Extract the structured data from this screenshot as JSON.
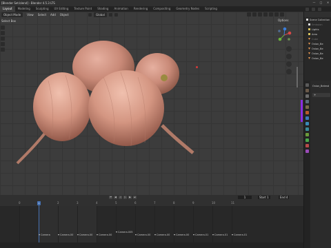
{
  "window": {
    "title": "[Blender Set.blend] - Blender 4.5.3 LTS"
  },
  "workspace_tabs": [
    "Layout",
    "Modeling",
    "Sculpting",
    "UV Editing",
    "Texture Paint",
    "Shading",
    "Animation",
    "Rendering",
    "Compositing",
    "Geometry Nodes",
    "Scripting"
  ],
  "active_tab": "Layout",
  "viewport": {
    "menu": [
      "Object Mode",
      "View",
      "Select",
      "Add",
      "Object"
    ],
    "sub_menu": [
      "Select Box"
    ],
    "orientation": "Global",
    "options_label": "Options"
  },
  "outliner": {
    "rows": [
      {
        "label": "Scene Collection",
        "icon": "collection-icon",
        "dim": false
      },
      {
        "label": "Emission",
        "icon": "collection-icon",
        "dim": true
      },
      {
        "label": "Lights",
        "icon": "light-icon",
        "dim": false
      },
      {
        "label": "Area",
        "icon": "light-icon",
        "dim": false
      },
      {
        "label": "Cube",
        "icon": "mesh-icon",
        "dim": true
      },
      {
        "label": "Onion_Be",
        "icon": "mesh-icon",
        "dim": false
      },
      {
        "label": "Onion_Be",
        "icon": "mesh-icon",
        "dim": false
      },
      {
        "label": "Onion_Be",
        "icon": "mesh-icon",
        "dim": false
      },
      {
        "label": "Onion_Be",
        "icon": "mesh-icon",
        "dim": false
      }
    ]
  },
  "properties": {
    "object_name": "Onion_Belend",
    "field_label": "+"
  },
  "timeline": {
    "current_frame": "1",
    "start_label": "Start",
    "start_value": "1",
    "end_label": "End",
    "end_value": "4",
    "ticks": [
      "0",
      "1",
      "2",
      "3",
      "4",
      "5",
      "6",
      "7",
      "8",
      "9",
      "10",
      "11"
    ],
    "markers": [
      "Camera",
      "Camera.00",
      "Camera.00",
      "Camera.00",
      "Camera.005",
      "Camera.00",
      "Camera.00",
      "Camera.00",
      "Camera.01",
      "Camera.01",
      "Camera.01"
    ]
  },
  "colors": {
    "accent": "#4772b3",
    "onion_skin": "#c98a78",
    "viewport_bg": "#3c3c3c"
  }
}
